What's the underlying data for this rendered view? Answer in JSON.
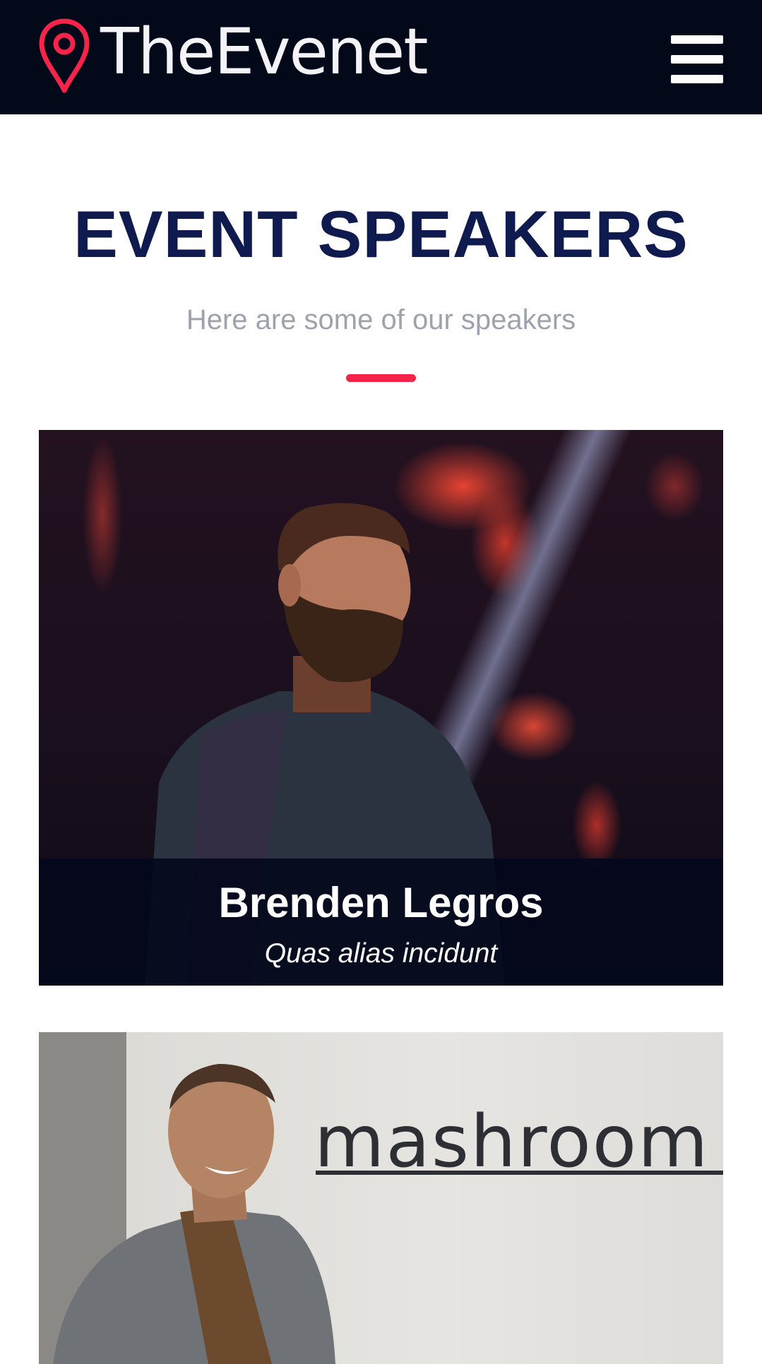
{
  "header": {
    "logo_text": "TheEvenet",
    "logo_icon": "map-pin-icon",
    "menu_icon": "hamburger-menu-icon",
    "background_color": "#040919",
    "accent_color": "#f6244a"
  },
  "section": {
    "title": "EVENT SPEAKERS",
    "subtitle": "Here are some of our speakers",
    "title_color": "#0f1b4f",
    "divider_color": "#f6244a"
  },
  "speakers": [
    {
      "name": "Brenden Legros",
      "role": "Quas alias incidunt"
    },
    {
      "sign_text": "mashroom"
    }
  ]
}
